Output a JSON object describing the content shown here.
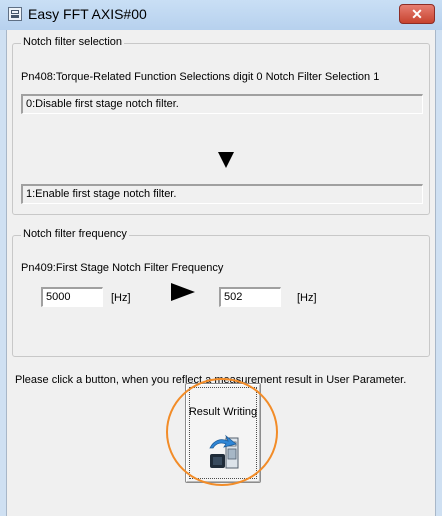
{
  "window": {
    "title": "Easy FFT AXIS#00",
    "close_label": "✕"
  },
  "notch_filter_selection": {
    "legend": "Notch filter selection",
    "param_label": "Pn408:Torque-Related Function Selections  digit 0 Notch Filter Selection 1",
    "current_value": "0:Disable first stage notch filter.",
    "new_value": "1:Enable first stage notch filter."
  },
  "notch_filter_frequency": {
    "legend": "Notch filter frequency",
    "param_label": "Pn409:First Stage Notch Filter Frequency",
    "current_value": "5000",
    "current_unit": "[Hz]",
    "new_value": "502",
    "new_unit": "[Hz]"
  },
  "instruction": "Please click a button, when you reflect a measurement result in User Parameter.",
  "result_button": {
    "label": "Result Writing"
  },
  "icons": [
    "window-app-icon",
    "close-icon",
    "arrow-down-icon",
    "arrow-right-icon",
    "result-writing-icon"
  ],
  "colors": {
    "highlight": "#f28c28",
    "close_button": "#c7432f"
  }
}
